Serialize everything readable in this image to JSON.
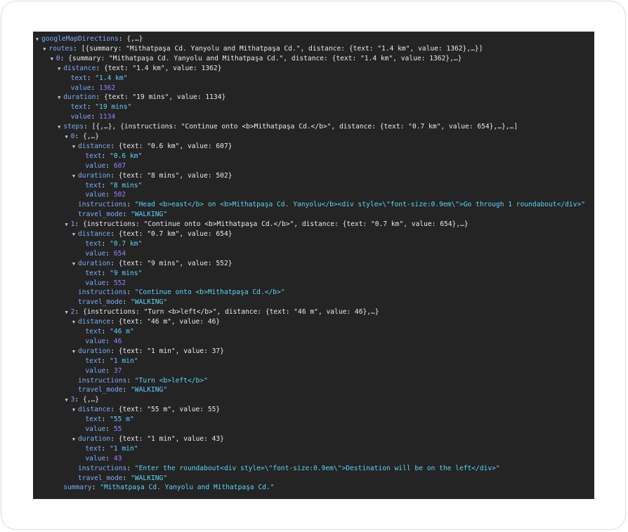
{
  "rows": [
    {
      "arrow": true,
      "key": "googleMapDirections",
      "summary": "{,…}"
    },
    {
      "arrow": true,
      "key": "routes",
      "summary": "[{summary: \"Mithatpaşa Cd. Yanyolu and Mithatpaşa Cd.\", distance: {text: \"1.4 km\", value: 1362},…}]"
    },
    {
      "arrow": true,
      "key": "0",
      "summary": "{summary: \"Mithatpaşa Cd. Yanyolu and Mithatpaşa Cd.\", distance: {text: \"1.4 km\", value: 1362},…}"
    },
    {
      "arrow": true,
      "key": "distance",
      "summary": "{text: \"1.4 km\", value: 1362}"
    },
    {
      "arrow": false,
      "key": "text",
      "str": "\"1.4 km\""
    },
    {
      "arrow": false,
      "key": "value",
      "num": "1362"
    },
    {
      "arrow": true,
      "key": "duration",
      "summary": "{text: \"19 mins\", value: 1134}"
    },
    {
      "arrow": false,
      "key": "text",
      "str": "\"19 mins\""
    },
    {
      "arrow": false,
      "key": "value",
      "num": "1134"
    },
    {
      "arrow": true,
      "key": "steps",
      "summary": "[{,…}, {instructions: \"Continue onto <b>Mithatpaşa Cd.</b>\", distance: {text: \"0.7 km\", value: 654},…},…]"
    },
    {
      "arrow": true,
      "key": "0",
      "summary": "{,…}"
    },
    {
      "arrow": true,
      "key": "distance",
      "summary": "{text: \"0.6 km\", value: 607}"
    },
    {
      "arrow": false,
      "key": "text",
      "str": "\"0.6 km\""
    },
    {
      "arrow": false,
      "key": "value",
      "num": "607"
    },
    {
      "arrow": true,
      "key": "duration",
      "summary": "{text: \"8 mins\", value: 502}"
    },
    {
      "arrow": false,
      "key": "text",
      "str": "\"8 mins\""
    },
    {
      "arrow": false,
      "key": "value",
      "num": "502"
    },
    {
      "arrow": false,
      "key": "instructions",
      "str": "\"Head <b>east</b> on <b>Mithatpaşa Cd. Yanyolu</b><div style=\\\"font-size:0.9em\\\">Go through 1 roundabout</div>\""
    },
    {
      "arrow": false,
      "key": "travel_mode",
      "str": "\"WALKING\""
    },
    {
      "arrow": true,
      "key": "1",
      "summary": "{instructions: \"Continue onto <b>Mithatpaşa Cd.</b>\", distance: {text: \"0.7 km\", value: 654},…}"
    },
    {
      "arrow": true,
      "key": "distance",
      "summary": "{text: \"0.7 km\", value: 654}"
    },
    {
      "arrow": false,
      "key": "text",
      "str": "\"0.7 km\""
    },
    {
      "arrow": false,
      "key": "value",
      "num": "654"
    },
    {
      "arrow": true,
      "key": "duration",
      "summary": "{text: \"9 mins\", value: 552}"
    },
    {
      "arrow": false,
      "key": "text",
      "str": "\"9 mins\""
    },
    {
      "arrow": false,
      "key": "value",
      "num": "552"
    },
    {
      "arrow": false,
      "key": "instructions",
      "str": "\"Continue onto <b>Mithatpaşa Cd.</b>\""
    },
    {
      "arrow": false,
      "key": "travel_mode",
      "str": "\"WALKING\""
    },
    {
      "arrow": true,
      "key": "2",
      "summary": "{instructions: \"Turn <b>left</b>\", distance: {text: \"46 m\", value: 46},…}"
    },
    {
      "arrow": true,
      "key": "distance",
      "summary": "{text: \"46 m\", value: 46}"
    },
    {
      "arrow": false,
      "key": "text",
      "str": "\"46 m\""
    },
    {
      "arrow": false,
      "key": "value",
      "num": "46"
    },
    {
      "arrow": true,
      "key": "duration",
      "summary": "{text: \"1 min\", value: 37}"
    },
    {
      "arrow": false,
      "key": "text",
      "str": "\"1 min\""
    },
    {
      "arrow": false,
      "key": "value",
      "num": "37"
    },
    {
      "arrow": false,
      "key": "instructions",
      "str": "\"Turn <b>left</b>\""
    },
    {
      "arrow": false,
      "key": "travel_mode",
      "str": "\"WALKING\""
    },
    {
      "arrow": true,
      "key": "3",
      "summary": "{,…}"
    },
    {
      "arrow": true,
      "key": "distance",
      "summary": "{text: \"55 m\", value: 55}"
    },
    {
      "arrow": false,
      "key": "text",
      "str": "\"55 m\""
    },
    {
      "arrow": false,
      "key": "value",
      "num": "55"
    },
    {
      "arrow": true,
      "key": "duration",
      "summary": "{text: \"1 min\", value: 43}"
    },
    {
      "arrow": false,
      "key": "text",
      "str": "\"1 min\""
    },
    {
      "arrow": false,
      "key": "value",
      "num": "43"
    },
    {
      "arrow": false,
      "key": "instructions",
      "str": "\"Enter the roundabout<div style=\\\"font-size:0.9em\\\">Destination will be on the left</div>\""
    },
    {
      "arrow": false,
      "key": "travel_mode",
      "str": "\"WALKING\""
    },
    {
      "arrow": false,
      "key": "summary",
      "str": "\"Mithatpaşa Cd. Yanyolu and Mithatpaşa Cd.\""
    }
  ]
}
